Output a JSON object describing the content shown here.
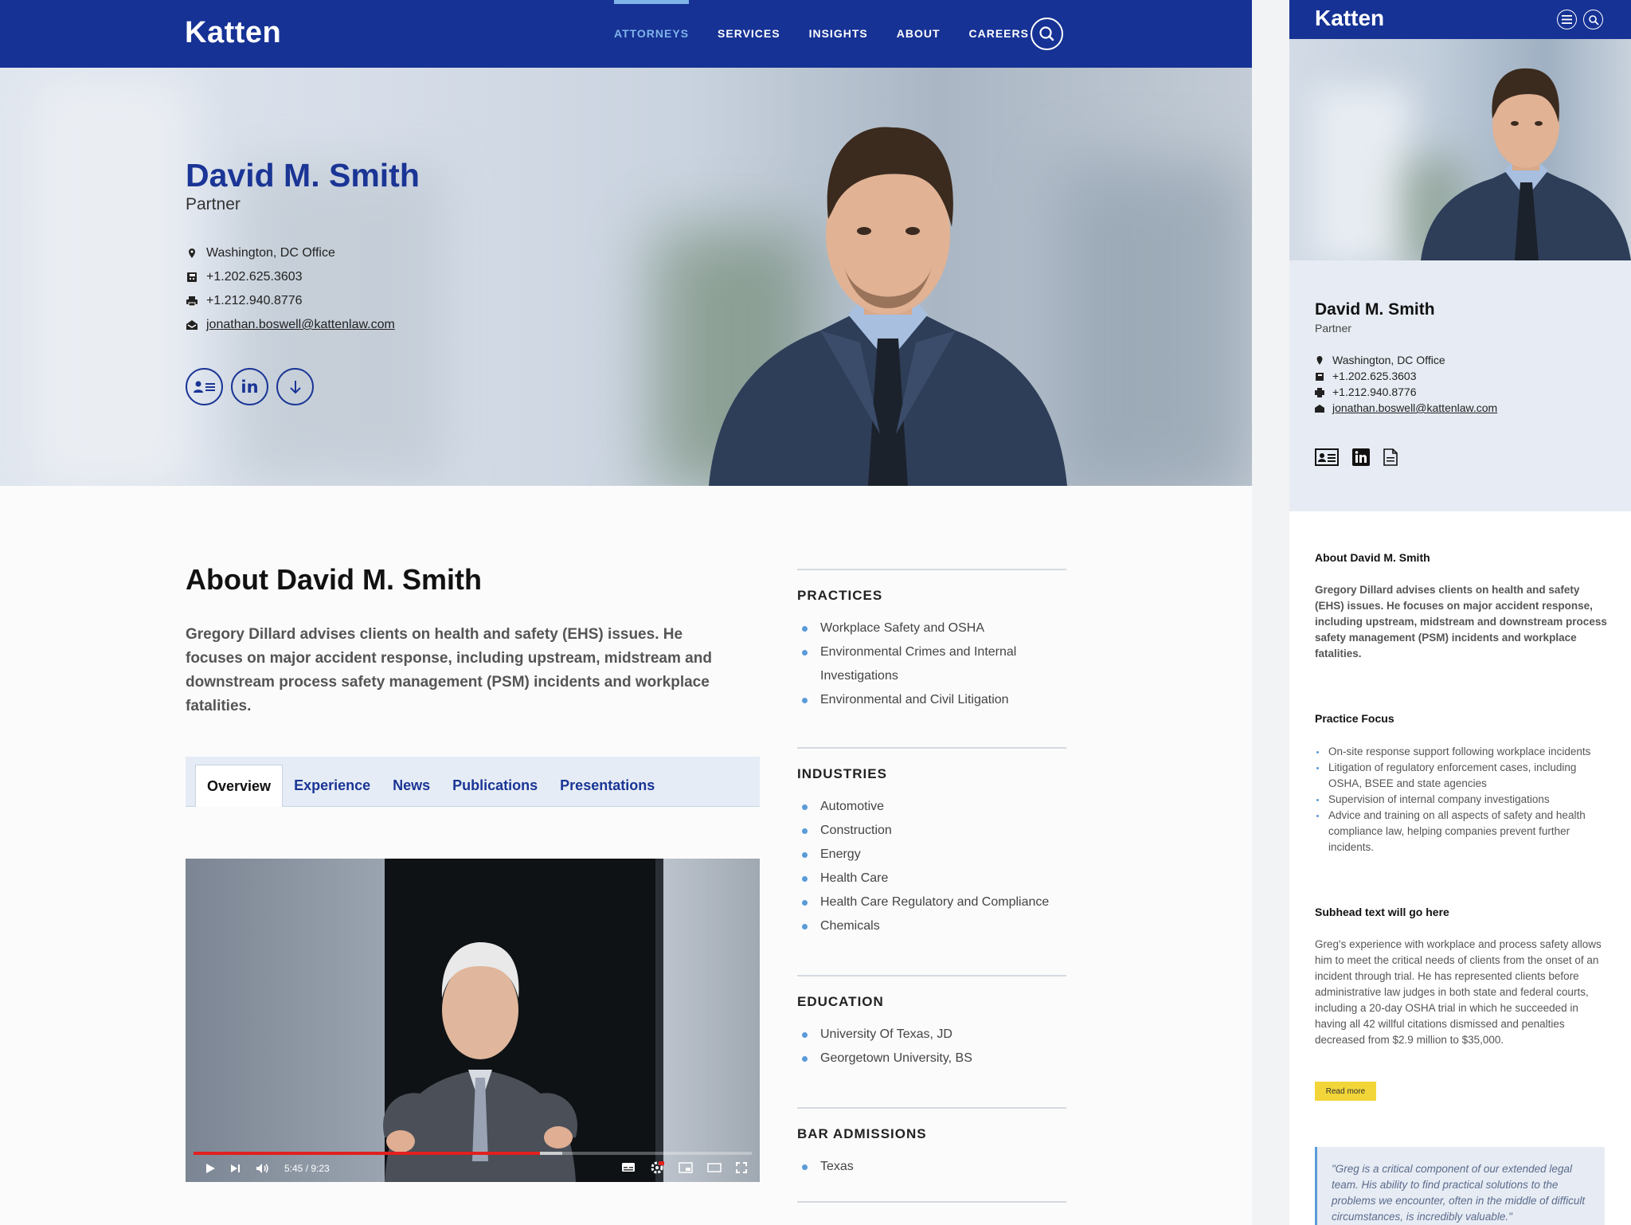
{
  "brand": "Katten",
  "nav": {
    "items": [
      {
        "label": "ATTORNEYS",
        "active": true
      },
      {
        "label": "SERVICES",
        "active": false
      },
      {
        "label": "INSIGHTS",
        "active": false
      },
      {
        "label": "ABOUT",
        "active": false
      },
      {
        "label": "CAREERS",
        "active": false
      }
    ]
  },
  "profile": {
    "name": "David M. Smith",
    "title": "Partner",
    "office": "Washington, DC Office",
    "phone": "+1.202.625.3603",
    "fax": "+1.212.940.8776",
    "email": "jonathan.boswell@kattenlaw.com"
  },
  "about": {
    "heading": "About David M. Smith",
    "summary": "Gregory Dillard advises clients on health and safety (EHS) issues. He focuses on major accident response, including upstream, midstream and downstream process safety management (PSM) incidents and workplace fatalities."
  },
  "tabs": [
    "Overview",
    "Experience",
    "News",
    "Publications",
    "Presentations"
  ],
  "active_tab": "Overview",
  "video": {
    "time": "5:45 / 9:23",
    "progress": 0.62
  },
  "sidebar": {
    "practices": {
      "heading": "PRACTICES",
      "items": [
        "Workplace Safety and OSHA",
        "Environmental Crimes and Internal Investigations",
        "Environmental and Civil Litigation"
      ]
    },
    "industries": {
      "heading": "INDUSTRIES",
      "items": [
        "Automotive",
        "Construction",
        "Energy",
        "Health Care",
        "Health Care Regulatory and Compliance",
        "Chemicals"
      ]
    },
    "education": {
      "heading": "EDUCATION",
      "items": [
        "University Of Texas, JD",
        "Georgetown University, BS"
      ]
    },
    "bar": {
      "heading": "BAR ADMISSIONS",
      "items": [
        "Texas"
      ]
    }
  },
  "mobile": {
    "about_heading": "About David M. Smith",
    "about_summary": "Gregory Dillard advises clients on health and safety (EHS) issues. He focuses on major accident response, including upstream, midstream and downstream process safety management (PSM) incidents and workplace fatalities.",
    "focus_heading": "Practice Focus",
    "focus_items": [
      "On-site response support following workplace incidents",
      "Litigation of regulatory enforcement cases, including OSHA, BSEE and state agencies",
      "Supervision of internal company investigations",
      "Advice and training on all aspects of safety and health compliance law, helping companies prevent further incidents."
    ],
    "subhead": "Subhead text will go here",
    "paragraph": "Greg's experience with workplace and process safety allows him to meet the critical needs of clients from the onset of an incident through trial. He has represented clients before administrative law judges in both state and federal courts, including a 20-day OSHA trial in which he succeeded in having all 42 willful citations dismissed and penalties decreased from $2.9 million to $35,000.",
    "read_more": "Read more",
    "quote": "\"Greg is a critical component of our extended legal team. His ability to find practical solutions to the problems we encounter, often in the middle of difficult circumstances, is incredibly valuable.\""
  },
  "icons": {
    "search": "search-icon",
    "location": "location-pin-icon",
    "phone": "phone-icon",
    "fax": "fax-icon",
    "email": "email-icon",
    "vcard": "vcard-icon",
    "linkedin": "linkedin-icon",
    "download": "download-icon",
    "menu": "menu-icon"
  },
  "colors": {
    "brand_blue": "#163295",
    "accent_light_blue": "#7fb4e8",
    "bullet_blue": "#5a9bd8",
    "button_yellow": "#f2d538"
  }
}
